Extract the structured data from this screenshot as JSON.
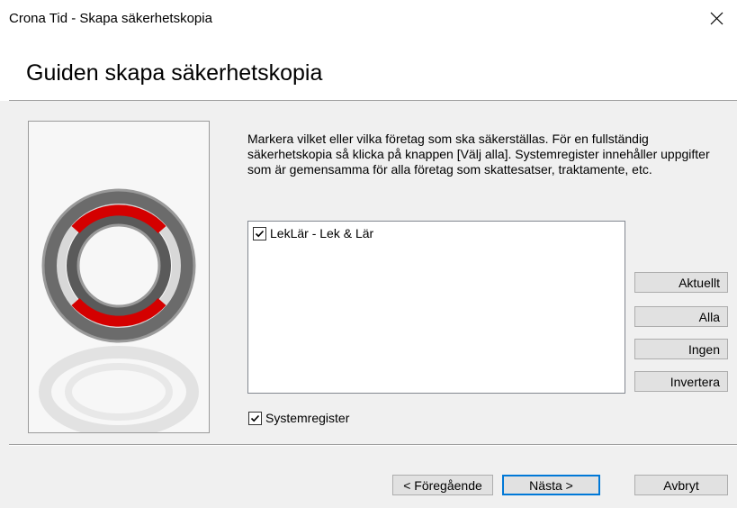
{
  "window": {
    "title": "Crona Tid - Skapa säkerhetskopia",
    "close_icon": "close-icon"
  },
  "header": {
    "heading": "Guiden skapa säkerhetskopia"
  },
  "picture": {
    "icon": "lifebuoy-icon",
    "colors": {
      "ring": "#555555",
      "stripe": "#dd0000"
    }
  },
  "main": {
    "description": "Markera vilket eller vilka företag som ska säkerställas. För en fullständig säkerhetskopia så klicka på knappen [Välj alla]. Systemregister innehåller uppgifter som är gemensamma för alla företag som skattesatser, traktamente, etc.",
    "companies": [
      {
        "label": "LekLär - Lek & Lär",
        "checked": true
      }
    ],
    "system_register": {
      "label": "Systemregister",
      "checked": true
    }
  },
  "side_buttons": {
    "current": "Aktuellt",
    "all": "Alla",
    "none": "Ingen",
    "invert": "Invertera"
  },
  "footer": {
    "back": "< Föregående",
    "next": "Nästa >",
    "cancel": "Avbryt"
  },
  "colors": {
    "accent": "#0078d7",
    "dialog_bg": "#f0f0f0"
  }
}
